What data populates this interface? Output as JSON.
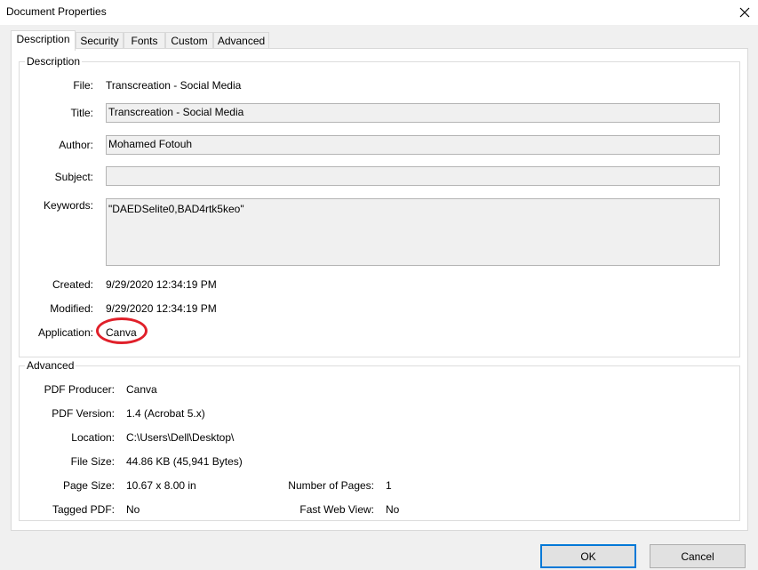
{
  "window": {
    "title": "Document Properties",
    "close_icon": "close-icon"
  },
  "tabs": [
    {
      "label": "Description",
      "active": true
    },
    {
      "label": "Security"
    },
    {
      "label": "Fonts"
    },
    {
      "label": "Custom"
    },
    {
      "label": "Advanced"
    }
  ],
  "description": {
    "group_label": "Description",
    "file_label": "File:",
    "file_value": "Transcreation - Social Media",
    "title_label": "Title:",
    "title_value": "Transcreation - Social Media",
    "author_label": "Author:",
    "author_value": "Mohamed Fotouh",
    "subject_label": "Subject:",
    "subject_value": "",
    "keywords_label": "Keywords:",
    "keywords_value": "\"DAEDSelite0,BAD4rtk5keo\"",
    "created_label": "Created:",
    "created_value": "9/29/2020 12:34:19 PM",
    "modified_label": "Modified:",
    "modified_value": "9/29/2020 12:34:19 PM",
    "application_label": "Application:",
    "application_value": "Canva",
    "highlight_color": "#e0202a"
  },
  "advanced": {
    "group_label": "Advanced",
    "pdf_producer_label": "PDF Producer:",
    "pdf_producer_value": "Canva",
    "pdf_version_label": "PDF Version:",
    "pdf_version_value": "1.4 (Acrobat 5.x)",
    "location_label": "Location:",
    "location_value": "C:\\Users\\Dell\\Desktop\\",
    "file_size_label": "File Size:",
    "file_size_value": "44.86 KB (45,941 Bytes)",
    "page_size_label": "Page Size:",
    "page_size_value": "10.67 x 8.00 in",
    "num_pages_label": "Number of Pages:",
    "num_pages_value": "1",
    "tagged_pdf_label": "Tagged PDF:",
    "tagged_pdf_value": "No",
    "fast_web_view_label": "Fast Web View:",
    "fast_web_view_value": "No"
  },
  "buttons": {
    "ok_label": "OK",
    "cancel_label": "Cancel"
  }
}
